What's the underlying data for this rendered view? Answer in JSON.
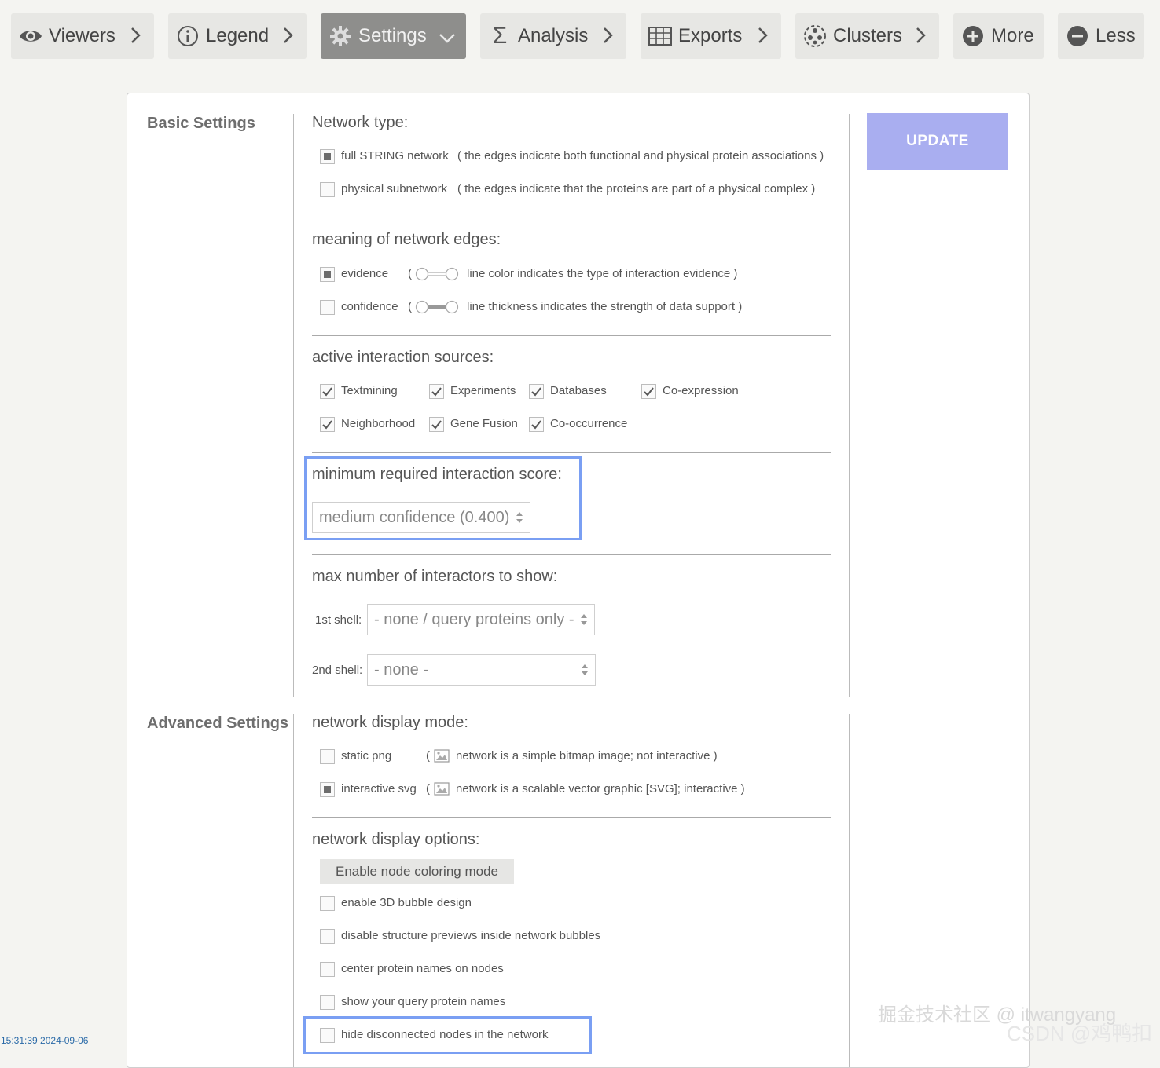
{
  "toolbar": {
    "viewers": "Viewers",
    "legend": "Legend",
    "settings": "Settings",
    "analysis": "Analysis",
    "exports": "Exports",
    "clusters": "Clusters",
    "more": "More",
    "less": "Less"
  },
  "basic": {
    "title": "Basic Settings",
    "update": "UPDATE",
    "network_type": {
      "heading": "Network type:",
      "full_label": "full STRING network",
      "full_desc": "( the edges indicate both functional and physical protein associations )",
      "full_checked": true,
      "physical_label": "physical subnetwork",
      "physical_desc": "( the edges indicate that the proteins are part of a physical complex )",
      "physical_checked": false
    },
    "edges": {
      "heading": "meaning of network edges:",
      "evidence_label": "evidence",
      "evidence_desc": "line color indicates the type of interaction evidence )",
      "evidence_checked": true,
      "confidence_label": "confidence",
      "confidence_desc": "line thickness indicates the strength of data support )",
      "confidence_checked": false,
      "paren": "("
    },
    "sources": {
      "heading": "active interaction sources:",
      "items": [
        "Textmining",
        "Experiments",
        "Databases",
        "Co-expression",
        "Neighborhood",
        "Gene Fusion",
        "Co-occurrence"
      ]
    },
    "score": {
      "heading": "minimum required interaction score:",
      "value": "medium confidence (0.400)"
    },
    "interactors": {
      "heading": "max number of interactors to show:",
      "first_label": "1st shell:",
      "first_value": "- none / query proteins only -",
      "second_label": "2nd shell:",
      "second_value": "- none -"
    }
  },
  "advanced": {
    "title": "Advanced Settings",
    "display_mode": {
      "heading": "network display mode:",
      "static_label": "static png",
      "static_desc": "network is a simple bitmap image; not interactive )",
      "static_checked": false,
      "svg_label": "interactive svg",
      "svg_desc": "network is a scalable vector graphic [SVG]; interactive )",
      "svg_checked": true,
      "paren": "("
    },
    "display_options": {
      "heading": "network display options:",
      "coloring_button": "Enable node coloring mode",
      "options": [
        "enable 3D bubble design",
        "disable structure previews inside network bubbles",
        "center protein names on nodes",
        "show your query protein names",
        "hide disconnected nodes in the network"
      ]
    }
  },
  "overlay": {
    "timestamp": "15:31:39 2024-09-06",
    "watermark_juejin": "掘金技术社区 @ itwangyang",
    "watermark_csdn": "CSDN @鸡鸭扣"
  },
  "colors": {
    "update_button": "#a9aef0",
    "highlight_border": "#7a9ff3",
    "active_tab": "#8e8e8c"
  }
}
